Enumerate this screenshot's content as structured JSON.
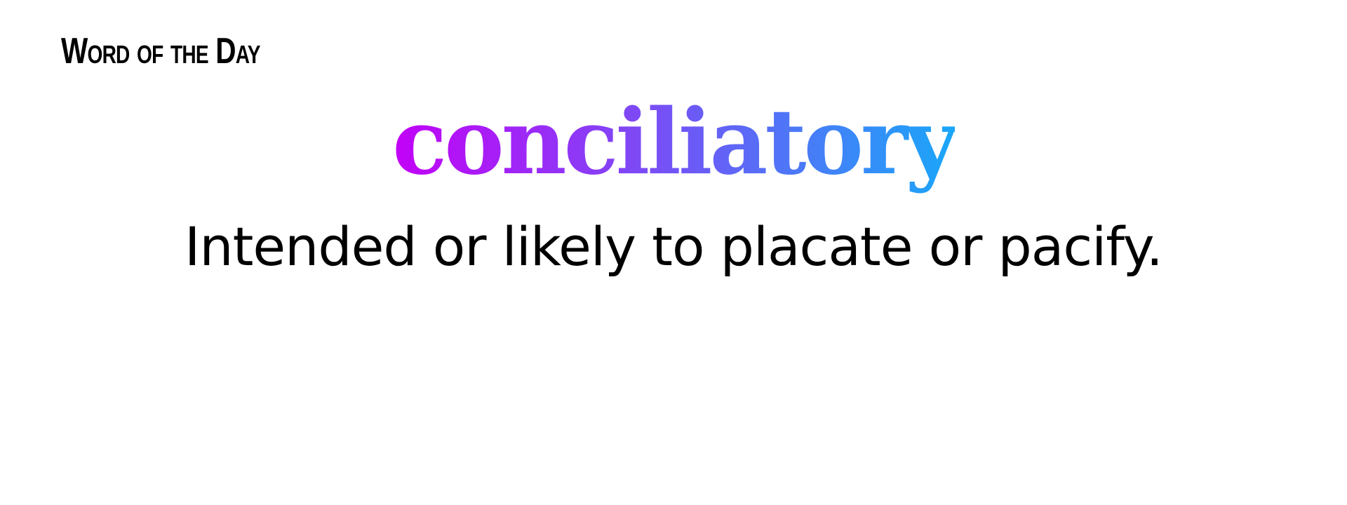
{
  "header": {
    "label": "Word of the Day"
  },
  "entry": {
    "word": "conciliatory",
    "definition": "Intended or likely to placate or pacify."
  },
  "colors": {
    "gradient_start": "#c301f7",
    "gradient_mid": "#7b4cf5",
    "gradient_end": "#1aa7f9",
    "text": "#000000",
    "background": "#ffffff"
  }
}
